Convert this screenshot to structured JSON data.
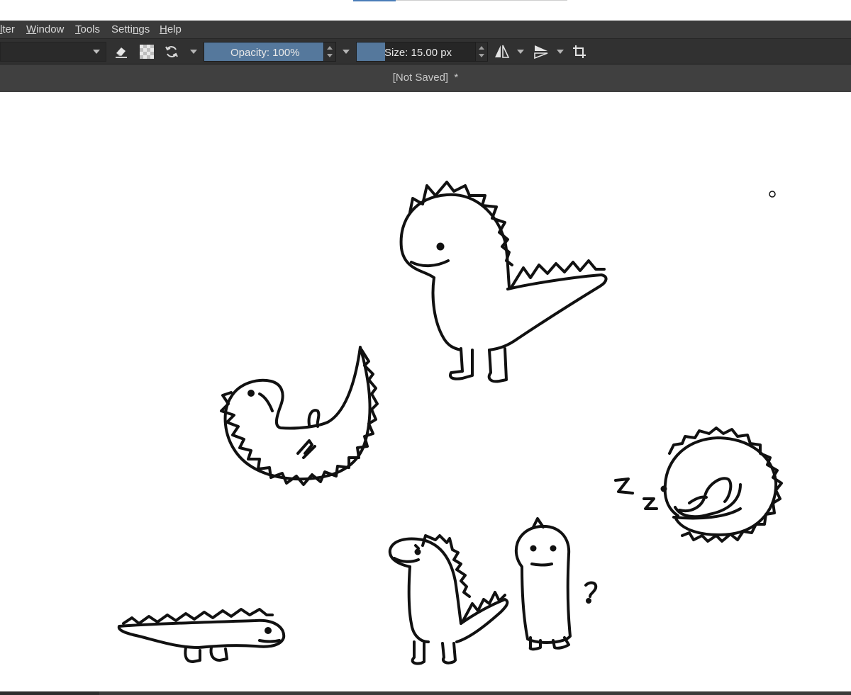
{
  "menubar": {
    "items": [
      {
        "label": "lter",
        "mnemonic": "l"
      },
      {
        "label": "Window",
        "mnemonic": "W"
      },
      {
        "label": "Tools",
        "mnemonic": "T"
      },
      {
        "label": "Settings",
        "mnemonic": "n"
      },
      {
        "label": "Help",
        "mnemonic": "H"
      }
    ]
  },
  "toolbar": {
    "opacity_label": "Opacity: 100%",
    "opacity_value": 100,
    "size_label": "Size: 15.00 px",
    "icons": [
      "eraser-icon",
      "alpha-checker-icon",
      "reload-preset-icon",
      "mirror-horizontal-icon",
      "mirror-vertical-icon",
      "crop-icon"
    ]
  },
  "document": {
    "title": "[Not Saved]  *"
  },
  "colors": {
    "menubar_bg": "#3a3a3a",
    "toolbar_bg": "#313131",
    "docbar_bg": "#404040",
    "slider_fill": "#55789c",
    "canvas_bg": "#ffffff",
    "ink": "#111111"
  },
  "canvas": {
    "drawings": [
      "standing-dinosaur",
      "lying-dinosaur",
      "sleeping-dinosaur",
      "crawling-dinosaur",
      "small-dinosaur",
      "blob-creature"
    ],
    "annotations": {
      "sleep_z": "z z",
      "question_mark": "?"
    }
  }
}
